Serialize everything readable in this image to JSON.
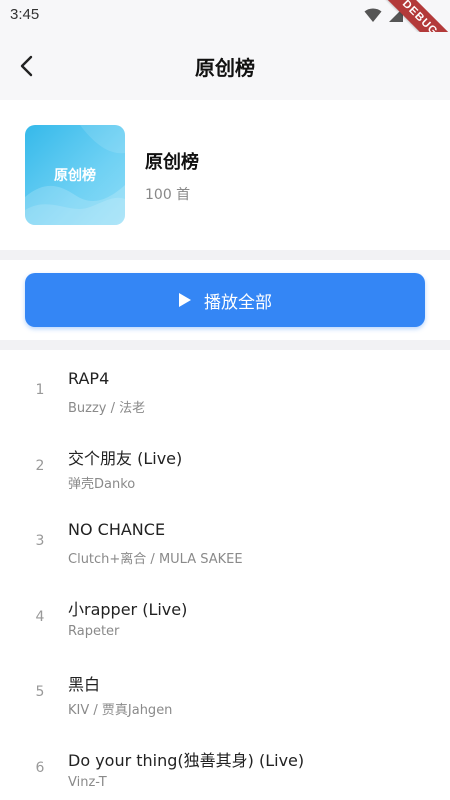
{
  "status_bar": {
    "time": "3:45",
    "debug_label": "DEBUG"
  },
  "app_bar": {
    "title": "原创榜",
    "back_icon": "chevron-left-icon"
  },
  "header": {
    "cover_text": "原创榜",
    "name": "原创榜",
    "count": "100 首"
  },
  "play_all": {
    "label": "播放全部",
    "icon": "play-icon"
  },
  "colors": {
    "accent": "#3486f5",
    "cover_gradient_start": "#35b9ea",
    "cover_gradient_end": "#8ddcf7",
    "debug_ribbon": "#b33a3a"
  },
  "songs": [
    {
      "index": "1",
      "title": "RAP4",
      "artist": "Buzzy / 法老"
    },
    {
      "index": "2",
      "title": "交个朋友 (Live)",
      "artist": "弹壳Danko"
    },
    {
      "index": "3",
      "title": "NO CHANCE",
      "artist": "Clutch+离合 / MULA SAKEE"
    },
    {
      "index": "4",
      "title": "小rapper (Live)",
      "artist": "Rapeter"
    },
    {
      "index": "5",
      "title": "黑白",
      "artist": "KIV / 贾真Jahgen"
    },
    {
      "index": "6",
      "title": "Do your thing(独善其身) (Live)",
      "artist": "Vinz-T"
    }
  ]
}
